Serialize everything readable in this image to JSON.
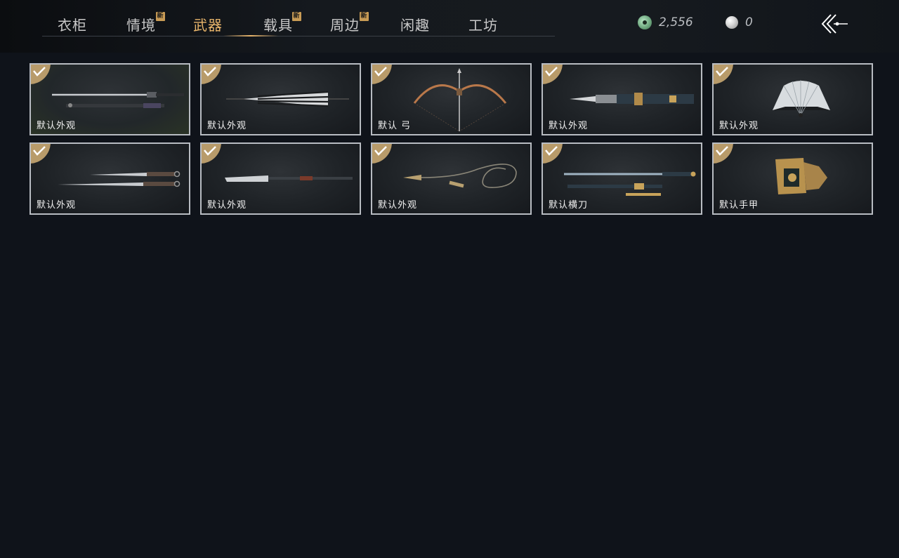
{
  "tabs": [
    {
      "label": "衣柜",
      "new": false,
      "active": false
    },
    {
      "label": "情境",
      "new": true,
      "active": false
    },
    {
      "label": "武器",
      "new": false,
      "active": true
    },
    {
      "label": "载具",
      "new": true,
      "active": false
    },
    {
      "label": "周边",
      "new": true,
      "active": false
    },
    {
      "label": "闲趣",
      "new": false,
      "active": false
    },
    {
      "label": "工坊",
      "new": false,
      "active": false
    }
  ],
  "new_badge": "新",
  "currency": {
    "jade": {
      "icon": "jade-coin-icon",
      "value": "2,556"
    },
    "pearl": {
      "icon": "pearl-icon",
      "value": "0"
    }
  },
  "items": [
    {
      "label": "默认外观",
      "icon": "twin-sword-icon",
      "equipped": true
    },
    {
      "label": "默认外观",
      "icon": "umbrella-icon",
      "equipped": true
    },
    {
      "label": "默认 弓",
      "icon": "bow-icon",
      "equipped": true
    },
    {
      "label": "默认外观",
      "icon": "spear-icon",
      "equipped": true
    },
    {
      "label": "默认外观",
      "icon": "fan-icon",
      "equipped": true
    },
    {
      "label": "默认外观",
      "icon": "dual-blade-icon",
      "equipped": true
    },
    {
      "label": "默认外观",
      "icon": "glaive-icon",
      "equipped": true
    },
    {
      "label": "默认外观",
      "icon": "rope-dart-icon",
      "equipped": true
    },
    {
      "label": "默认横刀",
      "icon": "hengdao-icon",
      "equipped": true
    },
    {
      "label": "默认手甲",
      "icon": "gauntlet-icon",
      "equipped": true
    }
  ],
  "colors": {
    "accent": "#e8b56b",
    "background": "#0f131a",
    "card_border": "#b8bcc2"
  }
}
